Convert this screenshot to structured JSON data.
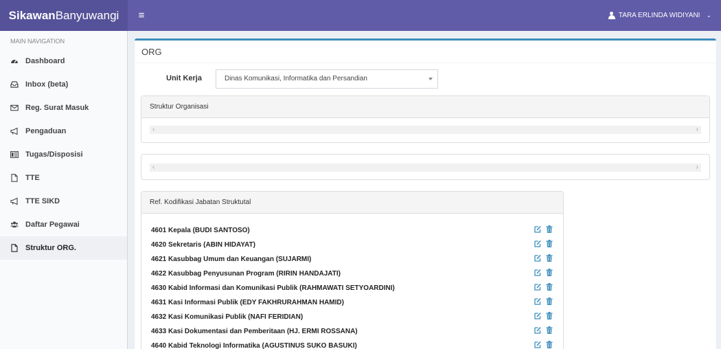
{
  "header": {
    "logo_bold": "Sikawan",
    "logo_rest": "Banyuwangi",
    "user_name": "TARA ERLINDA WIDIYANI"
  },
  "sidebar": {
    "header": "MAIN NAVIGATION",
    "items": [
      {
        "label": "Dashboard",
        "icon": "dashboard-icon"
      },
      {
        "label": "Inbox (beta)",
        "icon": "inbox-icon"
      },
      {
        "label": "Reg. Surat Masuk",
        "icon": "envelope-icon"
      },
      {
        "label": "Pengaduan",
        "icon": "bullhorn-icon"
      },
      {
        "label": "Tugas/Disposisi",
        "icon": "list-icon"
      },
      {
        "label": "TTE",
        "icon": "file-icon"
      },
      {
        "label": "TTE SIKD",
        "icon": "bullhorn-icon"
      },
      {
        "label": "Daftar Pegawai",
        "icon": "users-icon"
      },
      {
        "label": "Struktur ORG.",
        "icon": "file-icon",
        "active": true
      }
    ]
  },
  "main": {
    "title": "ORG",
    "unit_label": "Unit Kerja",
    "unit_value": "Dinas Komunikasi, Informatika dan Persandian",
    "struktur_title": "Struktur Organisasi",
    "ref_title": "Ref. Kodifikasi Jabatan Struktutal",
    "ref_rows": [
      "4601 Kepala (BUDI SANTOSO)",
      "4620 Sekretaris (ABIN HIDAYAT)",
      "4621 Kasubbag Umum dan Keuangan (SUJARMI)",
      "4622 Kasubbag Penyusunan Program (RIRIN HANDAJATI)",
      "4630 Kabid Informasi dan Komunikasi Publik (RAHMAWATI SETYOARDINI)",
      "4631 Kasi Informasi Publik (EDY FAKHRURAHMAN HAMID)",
      "4632 Kasi Komunikasi Publik (NAFI FERIDIAN)",
      "4633 Kasi Dokumentasi dan Pemberitaan (HJ. ERMI ROSSANA)",
      "4640 Kabid Teknologi Informatika (AGUSTINUS SUKO BASUKI)"
    ]
  },
  "colors": {
    "logo_bg": "#555299",
    "navbar_bg": "#605ca8",
    "box_accent": "#3c8dbc",
    "action_icon": "#3c8dbc"
  }
}
